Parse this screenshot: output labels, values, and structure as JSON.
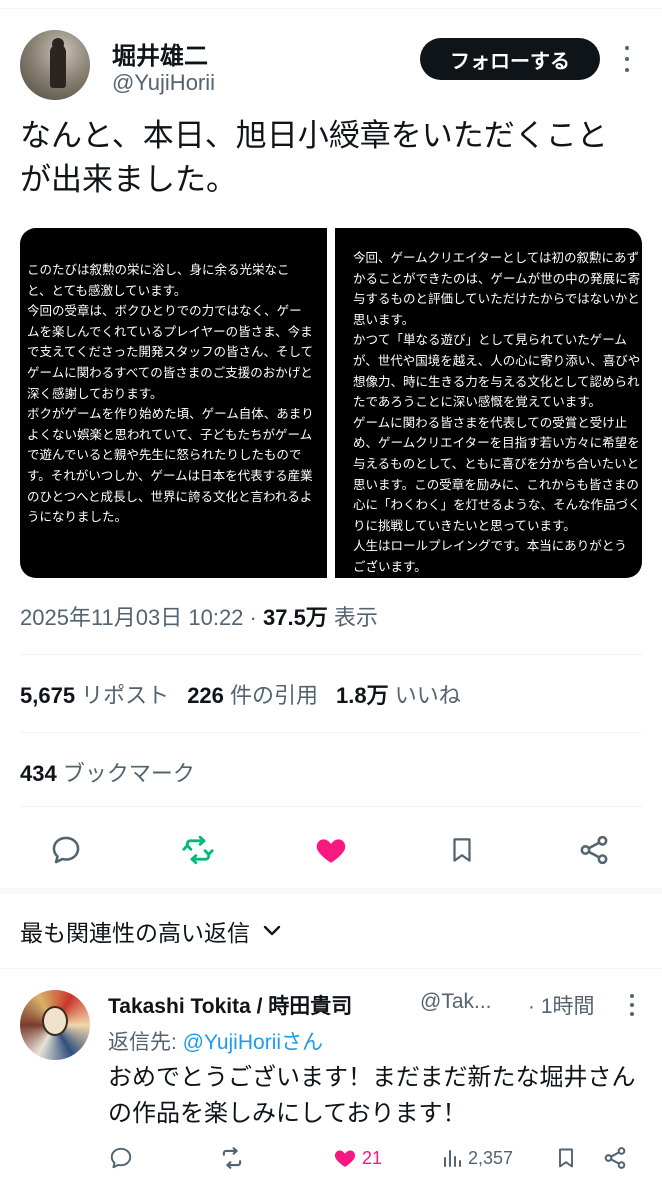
{
  "author": {
    "name": "堀井雄二",
    "handle": "@YujiHorii",
    "follow_label": "フォローする"
  },
  "tweet": {
    "text_line1": "なんと、本日、旭日小綬章をいただくこと",
    "text_line2": "が出来ました。"
  },
  "images": {
    "left_lines": [
      "このたびは叙勲の栄に浴し、身に余る光栄なこ",
      "と、とても感激しています。",
      "今回の受章は、ボクひとりでの力ではなく、ゲー",
      "ムを楽しんでくれているプレイヤーの皆さま、今ま",
      "で支えてくださった開発スタッフの皆さん、そして",
      "ゲームに関わるすべての皆さまのご支援のおかげと",
      "深く感謝しております。",
      "ボクがゲームを作り始めた頃、ゲーム自体、あまり",
      "よくない娯楽と思われていて、子どもたちがゲーム",
      "で遊んでいると親や先生に怒られたりしたもので",
      "す。それがいつしか、ゲームは日本を代表する産業",
      "のひとつへと成長し、世界に誇る文化と言われるよ",
      "うになりました。"
    ],
    "right_lines": [
      "今回、ゲームクリエイターとしては初の叙勲にあず",
      "かることができたのは、ゲームが世の中の発展に寄",
      "与するものと評価していただけたからではないかと",
      "思います。",
      "かつて「単なる遊び」として見られていたゲーム",
      "が、世代や国境を越え、人の心に寄り添い、喜びや",
      "想像力、時に生きる力を与える文化として認められ",
      "たであろうことに深い感慨を覚えています。",
      "ゲームに関わる皆さまを代表しての受賞と受け止",
      "め、ゲームクリエイターを目指す若い方々に希望を",
      "与えるものとして、ともに喜びを分かち合いたいと",
      "思います。この受章を励みに、これからも皆さまの",
      "心に「わくわく」を灯せるような、そんな作品づく",
      "りに挑戦していきたいと思っています。",
      "人生はロールプレイングです。本当にありがとう",
      "ございます。"
    ]
  },
  "meta": {
    "timestamp": "2025年11月03日 10:22",
    "separator": " · ",
    "views_count": "37.5万",
    "views_label": " 表示"
  },
  "stats": {
    "reposts_count": "5,675",
    "reposts_label": " リポスト",
    "quotes_count": "226",
    "quotes_label": " 件の引用",
    "likes_count": "1.8万",
    "likes_label": " いいね",
    "bookmarks_count": "434",
    "bookmarks_label": " ブックマーク"
  },
  "sort": {
    "label": "最も関連性の高い返信"
  },
  "reply": {
    "name": "Takashi Tokita / 時田貴司",
    "handle": "@Tak...",
    "time": "· 1時間",
    "reply_to_prefix": "返信先: ",
    "reply_to_link": "@YujiHoriiさん",
    "text": "おめでとうございます！まだまだ新たな堀井さんの作品を楽しみにしております！",
    "likes": "21",
    "views": "2,357"
  },
  "colors": {
    "text_primary": "#0f1419",
    "text_secondary": "#536471",
    "like_pink": "#f91880",
    "repost_green": "#00ba7c",
    "link_blue": "#1d9bf0"
  },
  "icons": [
    "reply-icon",
    "repost-icon",
    "like-icon",
    "bookmark-icon",
    "share-icon",
    "views-icon",
    "more-icon",
    "chevron-down-icon"
  ]
}
